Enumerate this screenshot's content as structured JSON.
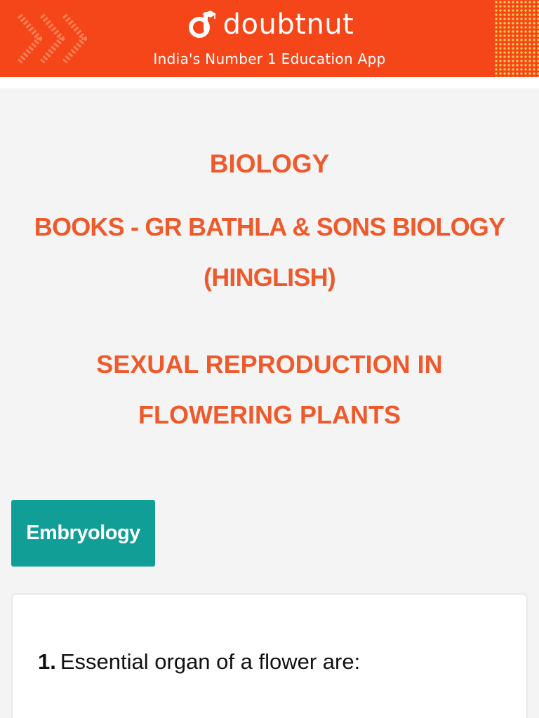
{
  "header": {
    "brand": "doubtnut",
    "tagline": "India's Number 1 Education App",
    "background_color": "#f5461a",
    "logo_icon": "doubtnut-logo-icon"
  },
  "document": {
    "subject": "BIOLOGY",
    "book_line1": "BOOKS - GR BATHLA & SONS BIOLOGY",
    "book_line2": "(HINGLISH)",
    "chapter_line1": "SEXUAL REPRODUCTION IN",
    "chapter_line2": "FLOWERING PLANTS",
    "title_color": "#ee5a2c"
  },
  "section": {
    "label": "Embryology",
    "color": "#109e96"
  },
  "questions": [
    {
      "number": "1.",
      "text": "Essential organ of a flower are:"
    }
  ]
}
